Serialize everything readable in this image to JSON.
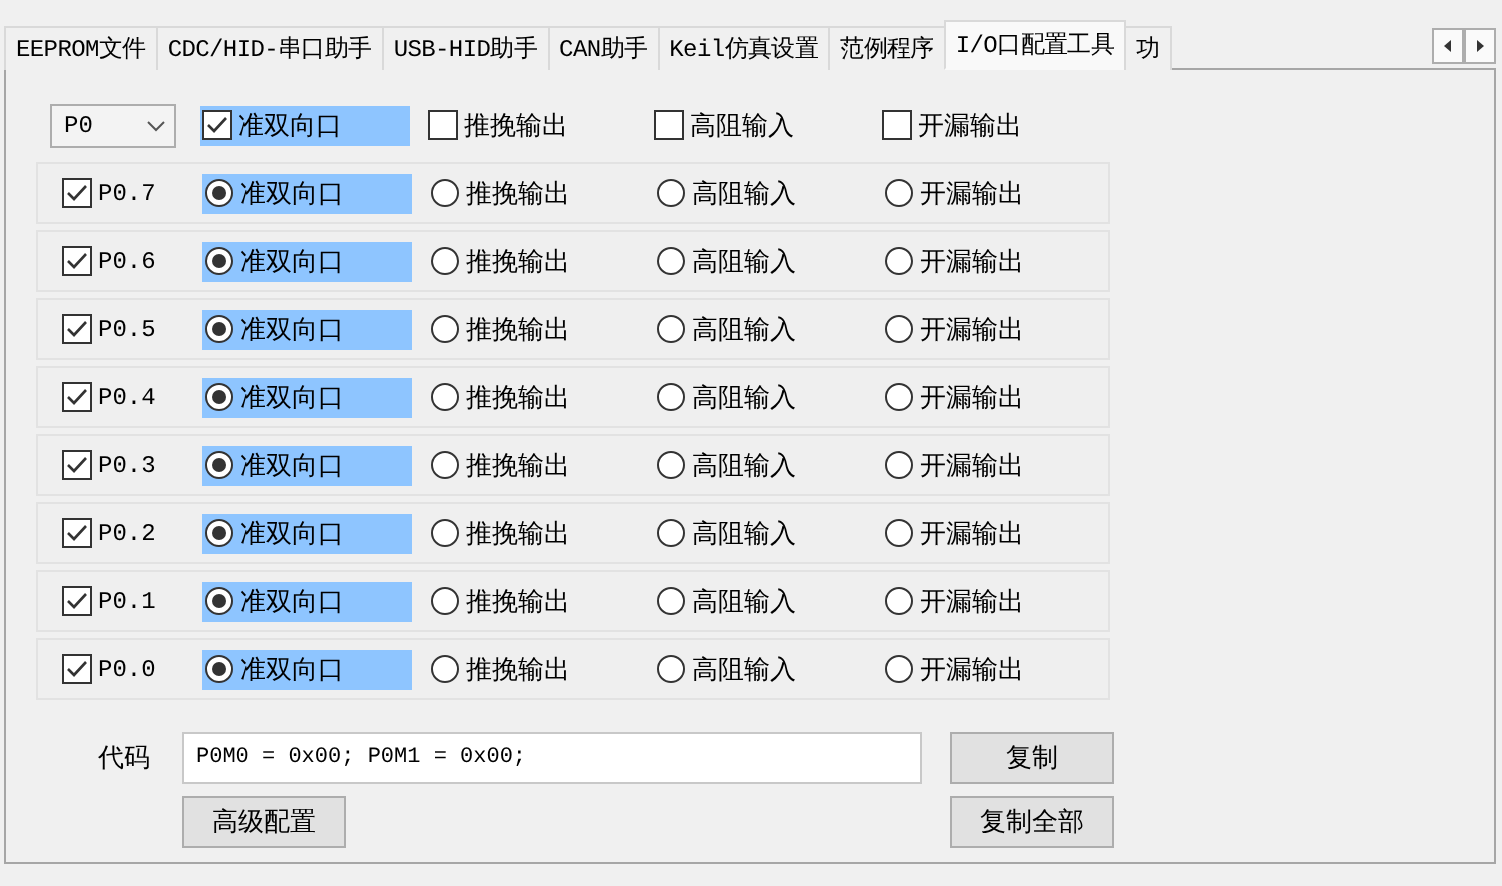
{
  "tabs": [
    {
      "label": "EEPROM文件",
      "selected": false
    },
    {
      "label": "CDC/HID-串口助手",
      "selected": false
    },
    {
      "label": "USB-HID助手",
      "selected": false
    },
    {
      "label": "CAN助手",
      "selected": false
    },
    {
      "label": "Keil仿真设置",
      "selected": false
    },
    {
      "label": "范例程序",
      "selected": false
    },
    {
      "label": "I/O口配置工具",
      "selected": true
    },
    {
      "label": "功",
      "selected": false
    }
  ],
  "port_select": {
    "value": "P0"
  },
  "port_modes": [
    {
      "label": "准双向口",
      "checked": true
    },
    {
      "label": "推挽输出",
      "checked": false
    },
    {
      "label": "高阻输入",
      "checked": false
    },
    {
      "label": "开漏输出",
      "checked": false
    }
  ],
  "pins": [
    {
      "name": "P0.7",
      "enabled": true,
      "modes": [
        {
          "label": "准双向口",
          "selected": true
        },
        {
          "label": "推挽输出",
          "selected": false
        },
        {
          "label": "高阻输入",
          "selected": false
        },
        {
          "label": "开漏输出",
          "selected": false
        }
      ]
    },
    {
      "name": "P0.6",
      "enabled": true,
      "modes": [
        {
          "label": "准双向口",
          "selected": true
        },
        {
          "label": "推挽输出",
          "selected": false
        },
        {
          "label": "高阻输入",
          "selected": false
        },
        {
          "label": "开漏输出",
          "selected": false
        }
      ]
    },
    {
      "name": "P0.5",
      "enabled": true,
      "modes": [
        {
          "label": "准双向口",
          "selected": true
        },
        {
          "label": "推挽输出",
          "selected": false
        },
        {
          "label": "高阻输入",
          "selected": false
        },
        {
          "label": "开漏输出",
          "selected": false
        }
      ]
    },
    {
      "name": "P0.4",
      "enabled": true,
      "modes": [
        {
          "label": "准双向口",
          "selected": true
        },
        {
          "label": "推挽输出",
          "selected": false
        },
        {
          "label": "高阻输入",
          "selected": false
        },
        {
          "label": "开漏输出",
          "selected": false
        }
      ]
    },
    {
      "name": "P0.3",
      "enabled": true,
      "modes": [
        {
          "label": "准双向口",
          "selected": true
        },
        {
          "label": "推挽输出",
          "selected": false
        },
        {
          "label": "高阻输入",
          "selected": false
        },
        {
          "label": "开漏输出",
          "selected": false
        }
      ]
    },
    {
      "name": "P0.2",
      "enabled": true,
      "modes": [
        {
          "label": "准双向口",
          "selected": true
        },
        {
          "label": "推挽输出",
          "selected": false
        },
        {
          "label": "高阻输入",
          "selected": false
        },
        {
          "label": "开漏输出",
          "selected": false
        }
      ]
    },
    {
      "name": "P0.1",
      "enabled": true,
      "modes": [
        {
          "label": "准双向口",
          "selected": true
        },
        {
          "label": "推挽输出",
          "selected": false
        },
        {
          "label": "高阻输入",
          "selected": false
        },
        {
          "label": "开漏输出",
          "selected": false
        }
      ]
    },
    {
      "name": "P0.0",
      "enabled": true,
      "modes": [
        {
          "label": "准双向口",
          "selected": true
        },
        {
          "label": "推挽输出",
          "selected": false
        },
        {
          "label": "高阻输入",
          "selected": false
        },
        {
          "label": "开漏输出",
          "selected": false
        }
      ]
    }
  ],
  "code": {
    "label": "代码",
    "value": "P0M0 = 0x00; P0M1 = 0x00;"
  },
  "buttons": {
    "copy": "复制",
    "copy_all": "复制全部",
    "advanced": "高级配置"
  }
}
